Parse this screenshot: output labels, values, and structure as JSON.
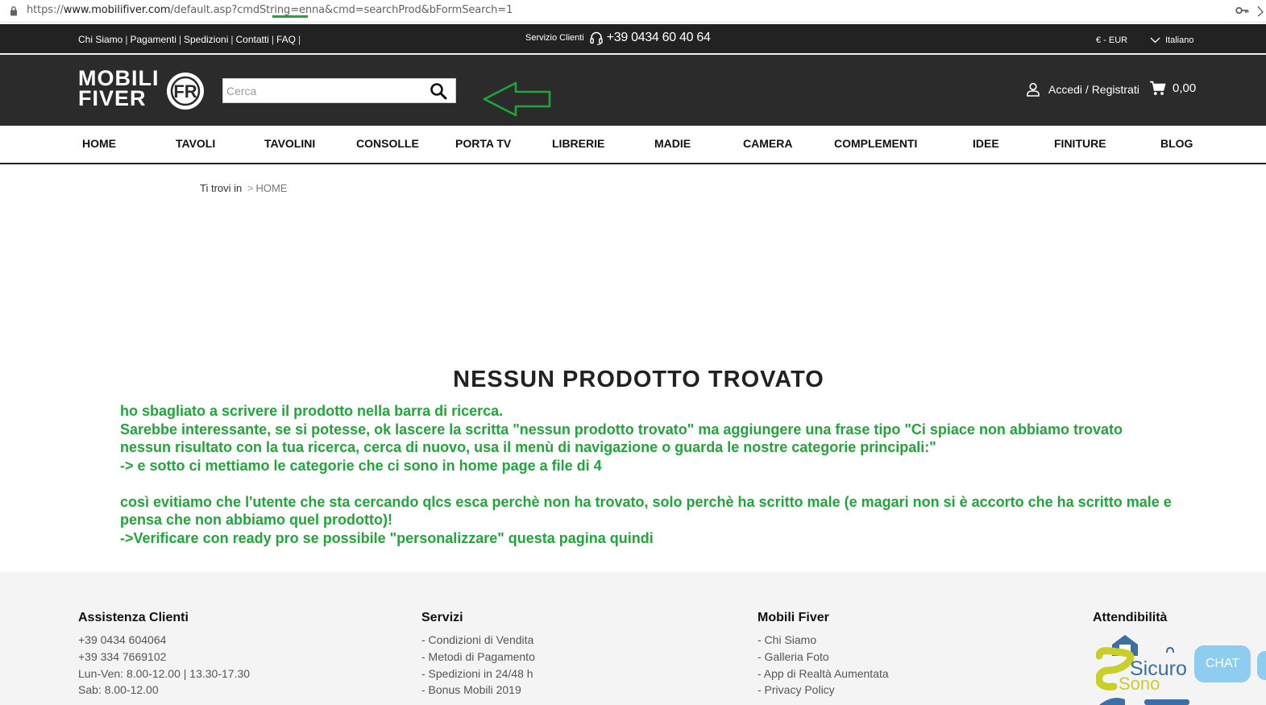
{
  "browser": {
    "url_base": "https://",
    "url_host": "www.mobilifiver.com",
    "url_path": "/default.asp?cmdString=enna&cmd=searchProd&bFormSearch=1"
  },
  "topbar": {
    "links": [
      "Chi Siamo",
      "Pagamenti",
      "Spedizioni",
      "Contatti",
      "FAQ"
    ],
    "separator": "|",
    "service_label": "Servizio Clienti",
    "phone": "+39 0434 60 40 64",
    "currency": "€ - EUR",
    "language": "Italiano"
  },
  "header": {
    "logo_line1": "MOBILI",
    "logo_line2": "FIVER",
    "logo_mark": "FR",
    "search_placeholder": "Cerca",
    "account_label": "Accedi / Registrati",
    "cart_total": "0,00"
  },
  "nav": {
    "items": [
      "HOME",
      "TAVOLI",
      "TAVOLINI",
      "CONSOLLE",
      "PORTA TV",
      "LIBRERIE",
      "MADIE",
      "CAMERA",
      "COMPLEMENTI",
      "IDEE",
      "FINITURE",
      "BLOG"
    ]
  },
  "breadcrumb": {
    "prefix": "Ti trovi in",
    "sep": ">",
    "current": "HOME"
  },
  "main": {
    "title": "NESSUN PRODOTTO TROVATO",
    "annotation": [
      "ho sbagliato a scrivere il prodotto nella barra di ricerca.",
      "Sarebbe interessante, se si potesse, ok lascere la scritta \"nessun prodotto trovato\" ma aggiungere una frase tipo \"Ci spiace non abbiamo trovato nessun risultato con la tua ricerca, cerca di nuovo, usa il menù di navigazione o guarda le nostre categorie principali:\"",
      "-> e sotto ci mettiamo le categorie che ci sono in home page a file di 4",
      "così evitiamo che l'utente che sta cercando qlcs esca perchè non ha trovato, solo perchè ha scritto male (e magari non si è accorto che ha scritto male e pensa che non abbiamo quel prodotto)!",
      "->Verificare con ready pro se possibile \"personalizzare\" questa pagina quindi"
    ]
  },
  "footer": {
    "col1": {
      "title": "Assistenza Clienti",
      "lines": [
        "+39 0434 604064",
        "+39 334 7669102",
        "Lun-Ven: 8.00-12.00 | 13.30-17.30",
        "Sab: 8.00-12.00"
      ]
    },
    "col2": {
      "title": "Servizi",
      "lines": [
        "- Condizioni di Vendita",
        "- Metodi di Pagamento",
        "- Spedizioni in 24/48 h",
        "- Bonus Mobili 2019"
      ]
    },
    "col3": {
      "title": "Mobili Fiver",
      "lines": [
        "- Chi Siamo",
        "- Galleria Foto",
        "- App di Realtà Aumentata",
        "- Privacy Policy"
      ]
    },
    "col4": {
      "title": "Attendibilità",
      "badge_word1": "Sicuro",
      "badge_word2": "Sono"
    },
    "chat_label": "CHAT"
  },
  "colors": {
    "dark": "#222222",
    "header": "#2b2b2b",
    "annotation_green": "#22a53a",
    "chat_blue": "#8ecdf0",
    "badge_yellow": "#c9cf2a",
    "badge_blue": "#3c6fa6"
  }
}
